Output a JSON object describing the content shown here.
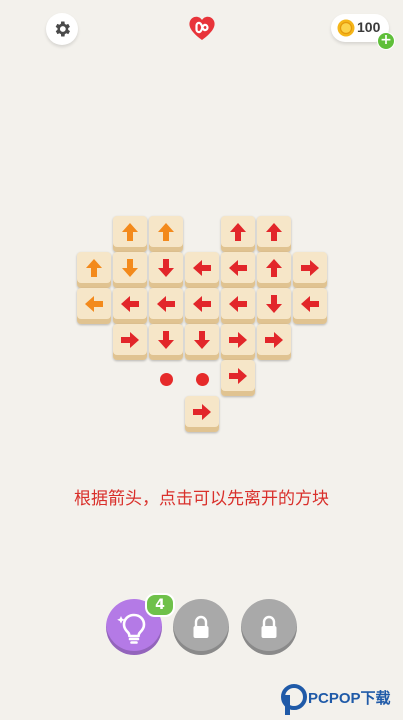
{
  "header": {
    "settings_icon": "gear-icon",
    "lives_icon": "heart-infinity-icon",
    "coins": "100",
    "coin_icon": "coin-icon",
    "add_coins_icon": "plus-icon"
  },
  "board": {
    "tiles": [
      {
        "dir": "up",
        "color": "orange"
      },
      {
        "dir": "up",
        "color": "orange"
      },
      {
        "dir": "up",
        "color": "red"
      },
      {
        "dir": "up",
        "color": "red"
      },
      {
        "dir": "up",
        "color": "orange"
      },
      {
        "dir": "down",
        "color": "orange"
      },
      {
        "dir": "down",
        "color": "red"
      },
      {
        "dir": "left",
        "color": "red"
      },
      {
        "dir": "left",
        "color": "red"
      },
      {
        "dir": "up",
        "color": "red"
      },
      {
        "dir": "right",
        "color": "red"
      },
      {
        "dir": "left",
        "color": "orange"
      },
      {
        "dir": "left",
        "color": "red"
      },
      {
        "dir": "left",
        "color": "red"
      },
      {
        "dir": "left",
        "color": "red"
      },
      {
        "dir": "left",
        "color": "red"
      },
      {
        "dir": "down",
        "color": "red"
      },
      {
        "dir": "left",
        "color": "red"
      },
      {
        "dir": "right",
        "color": "red"
      },
      {
        "dir": "down",
        "color": "red"
      },
      {
        "dir": "down",
        "color": "red"
      },
      {
        "dir": "right",
        "color": "red"
      },
      {
        "dir": "right",
        "color": "red"
      },
      {
        "dir": "right",
        "color": "red"
      },
      {
        "dir": "right",
        "color": "red"
      }
    ],
    "colors": {
      "orange": "#f38a1c",
      "red": "#e2262a"
    }
  },
  "hint_text": "根据箭头，点击可以先离开的方块",
  "powerups": {
    "hint": {
      "icon": "lightbulb-icon",
      "count": "4"
    },
    "locked_1": {
      "icon": "lock-icon"
    },
    "locked_2": {
      "icon": "lock-icon"
    }
  },
  "watermark": {
    "text": "PCPOP下载"
  }
}
